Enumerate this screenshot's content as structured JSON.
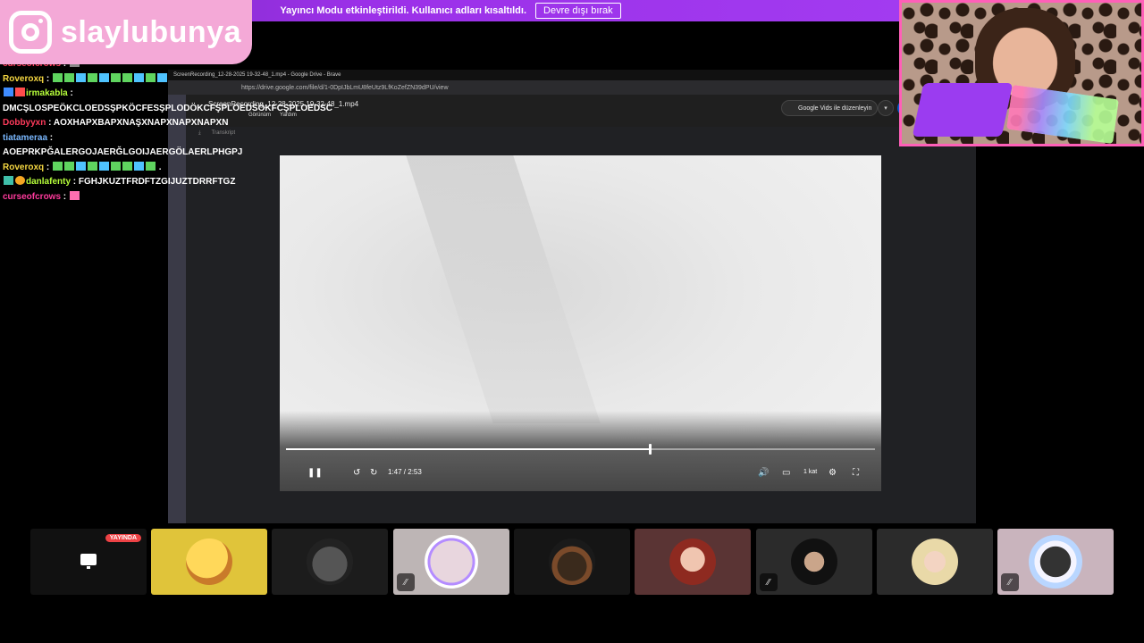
{
  "banner": {
    "text": "Yayıncı Modu etkinleştirildi. Kullanıcı adları kısaltıldı.",
    "button": "Devre dışı bırak"
  },
  "logo": {
    "handle": "slaylubunya",
    "icon": "instagram-icon"
  },
  "chat": [
    {
      "user": "curseofcrows",
      "text": "",
      "color": "#ff3b5c"
    },
    {
      "user": "Roveroxq",
      "text": "",
      "color": "#f5d742"
    },
    {
      "user": "irmakabla",
      "text": "DMCŞLOSPEÖKCLOEDSŞPKÖCFESŞPLODÖKCFŞPLOEDSÖKFCŞPLOEDSC",
      "color": "#b7ff3b"
    },
    {
      "user": "Dobbyyxn",
      "text": "AOXHAPXBAPXNAŞXNAPXNAPXNAPXN",
      "color": "#ff3b5c"
    },
    {
      "user": "tiatameraa",
      "text": "AOEPRKPĞALERGOJAERĞLGOIJAERGÖLAERLPHGPJ",
      "color": "#7ab8ff"
    },
    {
      "user": "Roveroxq",
      "text": ".",
      "color": "#f5d742"
    },
    {
      "user": "danlafenty",
      "text": "FGHJKUZTFRDFTZGIJUZTDRRFTGZ",
      "color": "#b7ff3b"
    },
    {
      "user": "curseofcrows",
      "text": "",
      "color": "#ff3b9d"
    }
  ],
  "browser": {
    "tab_title": "ScreenRecording_12-28-2025 19-32-48_1.mp4 - Google Drive - Brave",
    "url": "https://drive.google.com/file/d/1-0DpIJbLmU8feUtz9LfKoZefZN39dPU/view",
    "file_name": "ScreenRecording_12-28-2025 19-32-48_1.mp4",
    "menu": [
      "Görünüm",
      "Yardım"
    ],
    "vids_button": "Google Vids ile düzenleyin",
    "transcript": "Transkript"
  },
  "player": {
    "current_time": "1:47",
    "duration": "2:53",
    "progress": 0.618,
    "speed": "1 kat"
  },
  "tiles": [
    {
      "id": "screen-share",
      "live": "YAYINDA",
      "bg": "#111111"
    },
    {
      "id": "meme-face",
      "bg": "#e0c43a"
    },
    {
      "id": "skill-issue",
      "bg": "#1c1c1c"
    },
    {
      "id": "girl-ring",
      "bg": "#bdb5b5",
      "muted": true
    },
    {
      "id": "silhouette",
      "bg": "#151515"
    },
    {
      "id": "redhead",
      "bg": "#5a3434"
    },
    {
      "id": "cat-ears",
      "bg": "#2b2b2b",
      "muted": true
    },
    {
      "id": "blonde",
      "bg": "#2b2b2b"
    },
    {
      "id": "bunny",
      "bg": "#c9b4bd",
      "muted": true
    }
  ]
}
